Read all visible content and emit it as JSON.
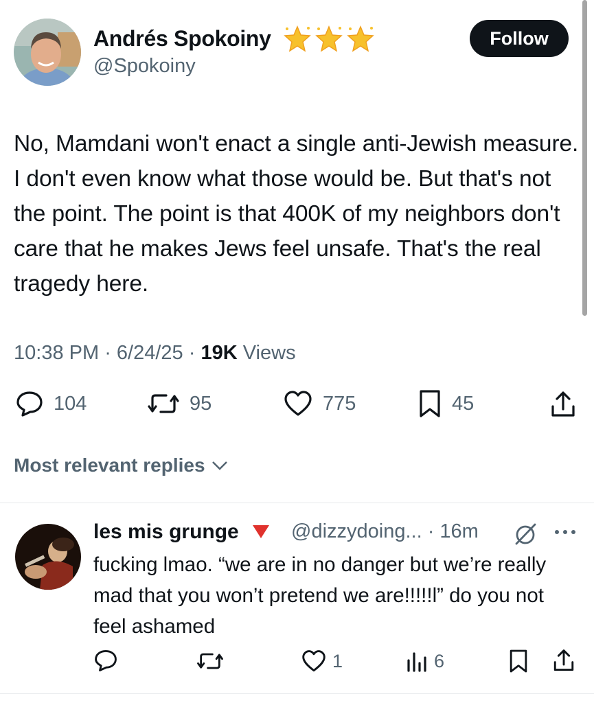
{
  "author": {
    "name": "Andrés Spokoiny",
    "handle": "@Spokoiny",
    "follow_label": "Follow"
  },
  "tweet": {
    "text": "No, Mamdani won't enact a single anti-Jewish measure. I don't even know what those would be. But that's not the point. The point is that 400K of my neighbors don't care that he makes Jews feel unsafe. That's the real tragedy here.",
    "time": "10:38 PM",
    "date": "6/24/25",
    "views_count": "19K",
    "views_label": "Views",
    "replies": "104",
    "reposts": "95",
    "likes": "775",
    "bookmarks": "45"
  },
  "replies_section": {
    "label": "Most relevant replies"
  },
  "reply": {
    "name": "les mis grunge",
    "handle": "@dizzydoing...",
    "age": "16m",
    "text": "fucking lmao. “we are in no danger but we’re really mad that you won’t pretend we are!!!!!l” do you not feel ashamed",
    "likes": "1",
    "views": "6"
  },
  "colors": {
    "text": "#0f1419",
    "secondary": "#536471",
    "follow_bg": "#0f1419",
    "star": "#f7c12c",
    "red_triangle": "#e0322d"
  }
}
